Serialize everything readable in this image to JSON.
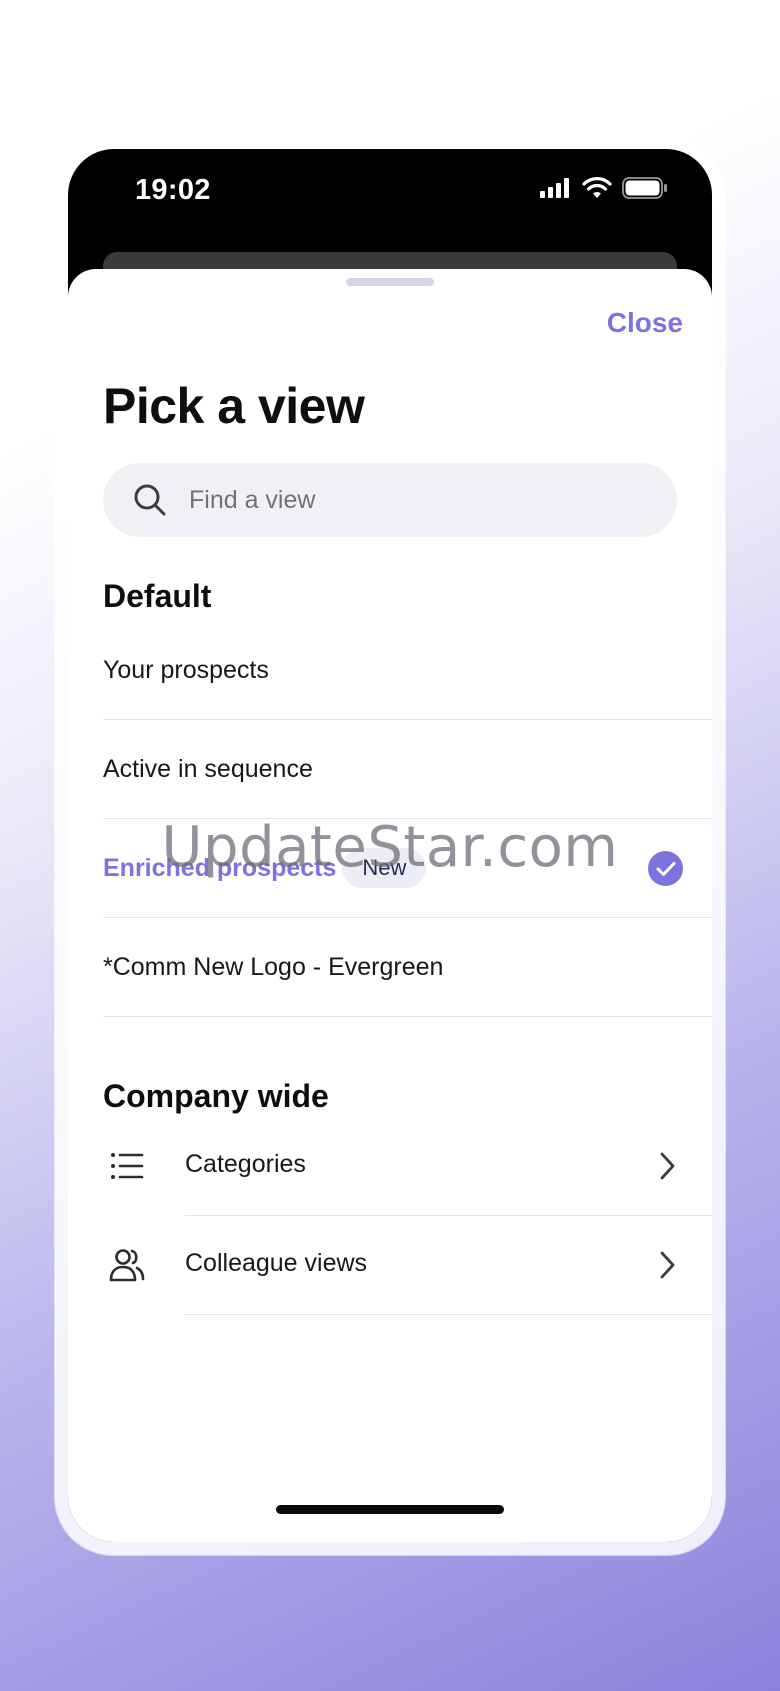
{
  "status_bar": {
    "time": "19:02"
  },
  "header": {
    "close_label": "Close",
    "title": "Pick a view"
  },
  "search": {
    "placeholder": "Find a view",
    "value": ""
  },
  "default_section": {
    "heading": "Default",
    "items": [
      {
        "label": "Your prospects"
      },
      {
        "label": "Active in sequence"
      },
      {
        "label": "Enriched prospects",
        "badge": "New",
        "selected": true
      },
      {
        "label": "*Comm New Logo - Evergreen"
      }
    ]
  },
  "company_section": {
    "heading": "Company wide",
    "items": [
      {
        "label": "Categories",
        "icon": "list-icon"
      },
      {
        "label": "Colleague views",
        "icon": "users-icon"
      }
    ]
  },
  "watermark": "UpdateStar.com",
  "colors": {
    "accent": "#7c72e0",
    "badge_bg": "#ededf6",
    "divider": "#e4e4ea"
  }
}
